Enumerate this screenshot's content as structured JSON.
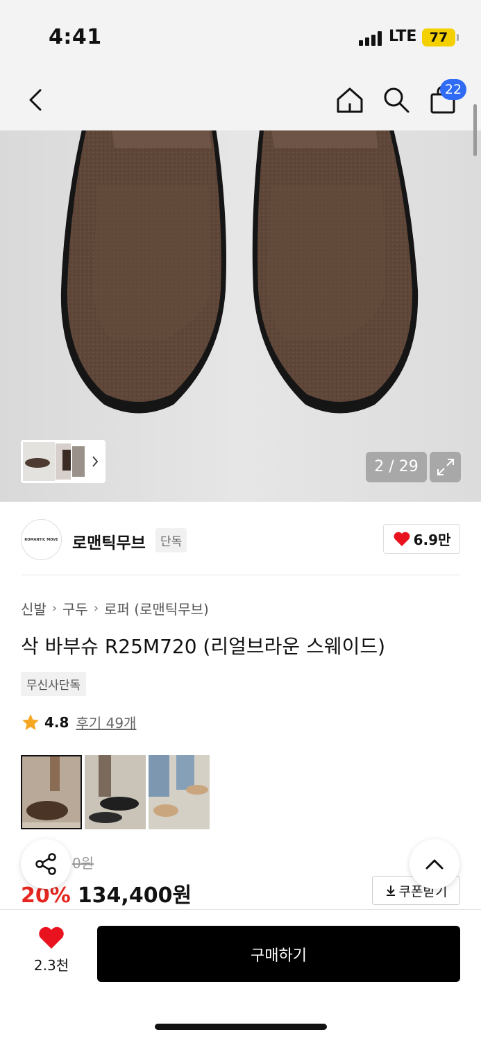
{
  "status": {
    "time": "4:41",
    "network": "LTE",
    "battery": "77"
  },
  "nav": {
    "cart_count": "22"
  },
  "gallery": {
    "counter": "2 / 29"
  },
  "brand": {
    "logo_text": "ROMANTIC MOVE",
    "name": "로맨틱무브",
    "tag": "단독",
    "likes": "6.9만"
  },
  "breadcrumb": [
    "신발",
    "구두",
    "로퍼 (로맨틱무브)"
  ],
  "product": {
    "title": "삭 바부슈 R25M720 (리얼브라운 스웨이드)",
    "exclusive_tag": "무신사단독",
    "rating": "4.8",
    "reviews": "후기 49개",
    "original_price": "0원",
    "discount": "20%",
    "price": "134,400원",
    "coupon_label": "쿠폰받기"
  },
  "bottom": {
    "wish_count": "2.3천",
    "buy_label": "구매하기"
  },
  "colors": {
    "accent_blue": "#2f6bf5",
    "discount_red": "#e5261f",
    "heart_red": "#e8131f",
    "star": "#f5a623",
    "buy_black": "#000000"
  }
}
